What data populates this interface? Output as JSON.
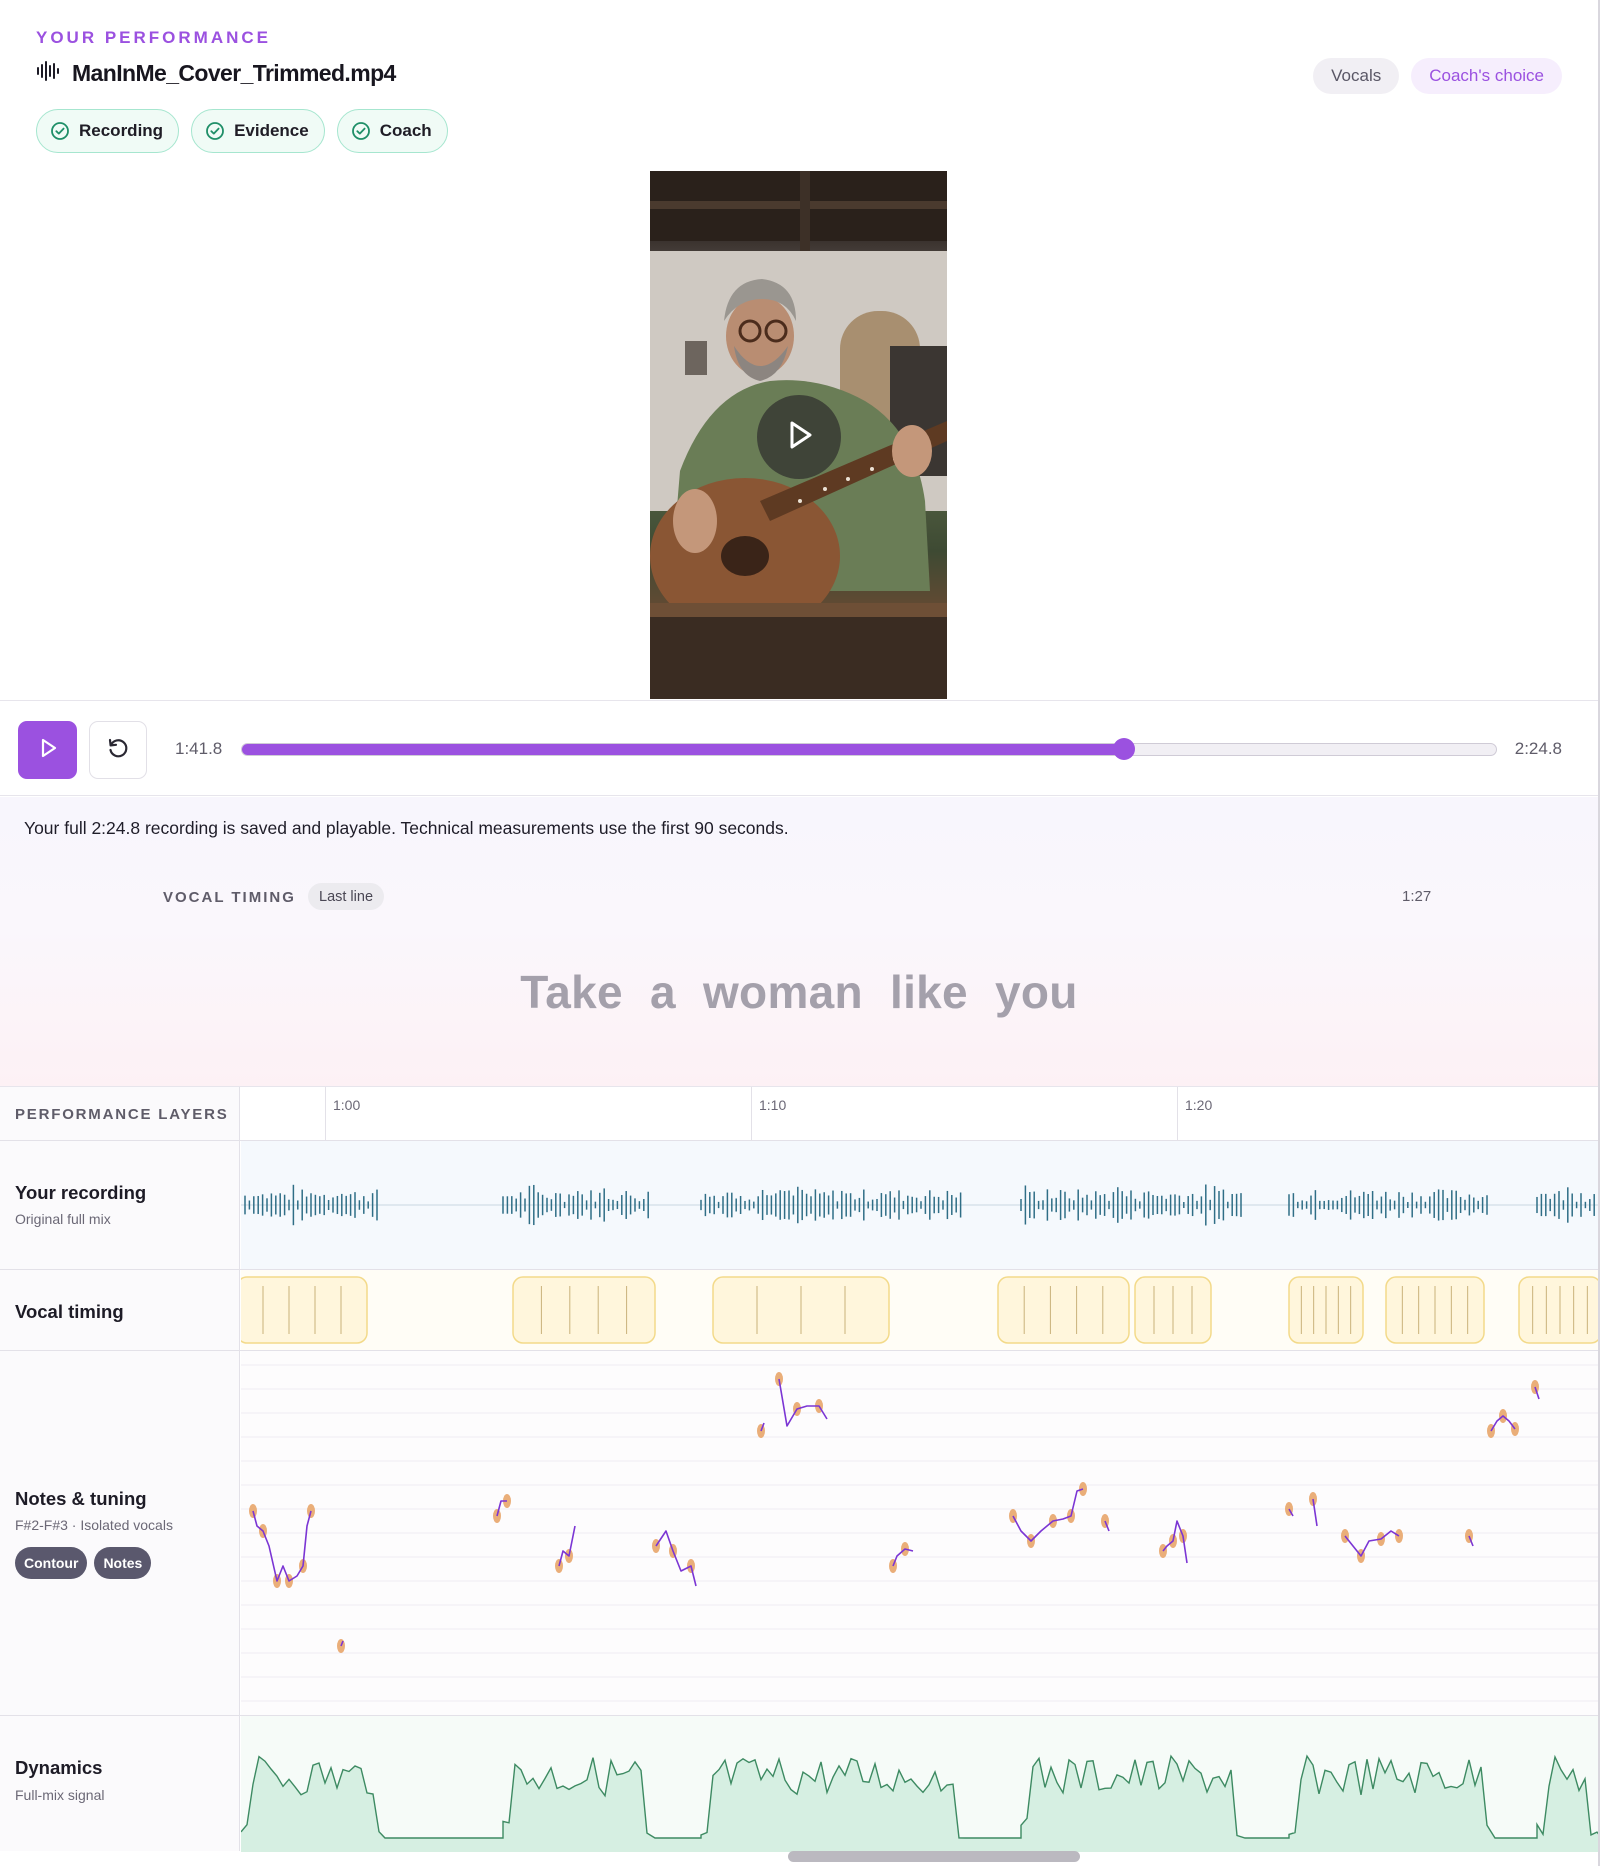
{
  "header": {
    "eyebrow": "YOUR PERFORMANCE",
    "file_name": "ManInMe_Cover_Trimmed.mp4",
    "status_chips": [
      {
        "label": "Recording"
      },
      {
        "label": "Evidence"
      },
      {
        "label": "Coach"
      }
    ],
    "mode_toggle": {
      "vocals": "Vocals",
      "coach": "Coach's choice"
    }
  },
  "colors": {
    "accent": "#9b51e0",
    "chip_border": "#a6e6cf",
    "waveform": "#2f6e86",
    "timing_block": "#f3da8a",
    "pitch_line": "#7b35d4",
    "pitch_note": "#e8a56a",
    "dynamics_fill": "#d6efe2",
    "dynamics_line": "#3d8a62"
  },
  "player": {
    "current_time": "1:41.8",
    "duration": "2:24.8",
    "progress": 0.703
  },
  "notice": "Your full 2:24.8 recording is saved and playable. Technical measurements use the first 90 seconds.",
  "vocal_timing": {
    "label": "VOCAL TIMING",
    "badge": "Last line",
    "time": "1:27",
    "lyric": "Take a woman like you"
  },
  "layers": {
    "heading": "PERFORMANCE LAYERS",
    "ruler": [
      "1:00",
      "1:10",
      "1:20"
    ],
    "recording": {
      "title": "Your recording",
      "subtitle": "Original full mix"
    },
    "timing": {
      "title": "Vocal timing"
    },
    "notes": {
      "title": "Notes & tuning",
      "subtitle": "F#2-F#3 · Isolated vocals",
      "toggles": [
        "Contour",
        "Notes"
      ]
    },
    "dynamics": {
      "title": "Dynamics",
      "subtitle": "Full-mix signal"
    }
  }
}
